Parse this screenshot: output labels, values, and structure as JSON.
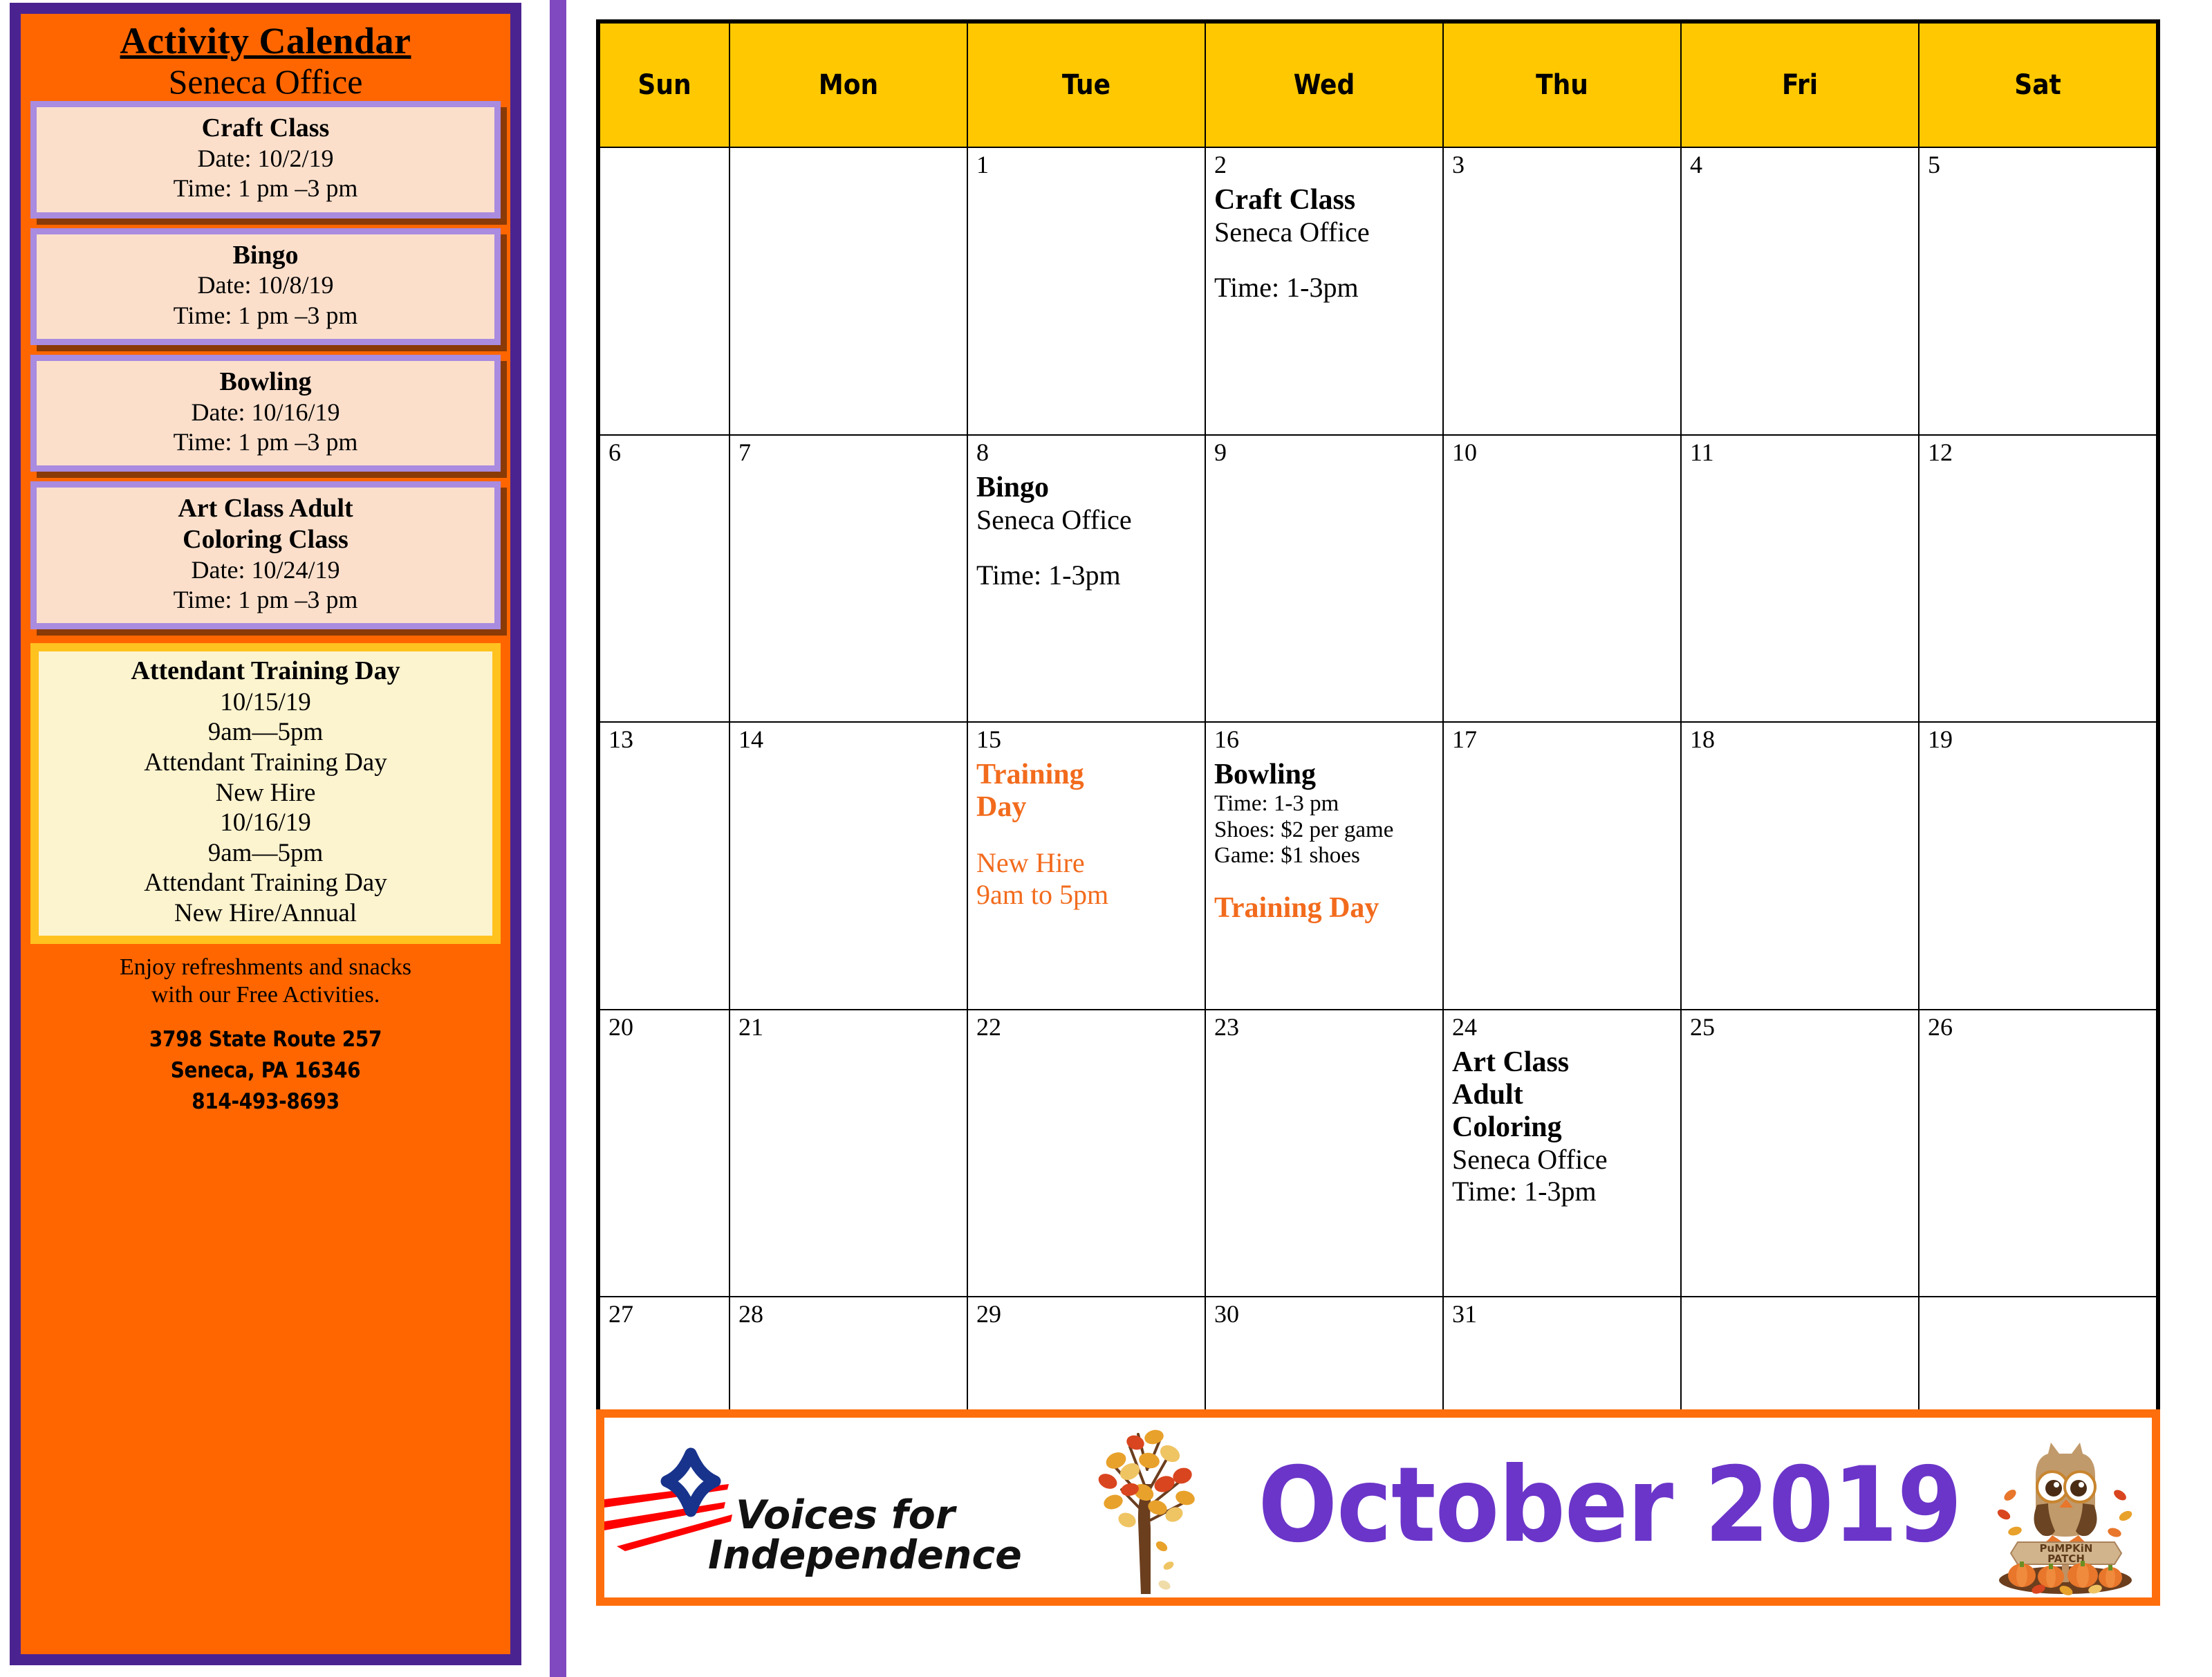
{
  "sidebar": {
    "title_main": "Activity Calendar",
    "title_sub": "Seneca Office",
    "events": [
      {
        "name": "Craft Class",
        "date": "Date: 10/2/19",
        "time": "Time: 1 pm –3 pm"
      },
      {
        "name": "Bingo",
        "date": "Date: 10/8/19",
        "time": "Time: 1 pm –3 pm"
      },
      {
        "name": "Bowling",
        "date": "Date: 10/16/19",
        "time": "Time: 1 pm –3 pm"
      },
      {
        "name": "Art Class Adult",
        "name2": "Coloring Class",
        "date": "Date: 10/24/19",
        "time": "Time: 1 pm –3 pm"
      }
    ],
    "training": {
      "title": "Attendant Training Day",
      "l1": "10/15/19",
      "l2": "9am—5pm",
      "l3": "Attendant Training Day",
      "l4": "New Hire",
      "l5": "10/16/19",
      "l6": "9am—5pm",
      "l7": "Attendant Training Day",
      "l8": "New Hire/Annual"
    },
    "note_line1": "Enjoy refreshments and snacks",
    "note_line2": "with our Free Activities.",
    "address_line1": "3798 State Route 257",
    "address_line2": "Seneca, PA 16346",
    "phone": "814-493-8693"
  },
  "calendar": {
    "weekday_headers": [
      "Sun",
      "Mon",
      "Tue",
      "Wed",
      "Thu",
      "Fri",
      "Sat"
    ],
    "weeks": [
      {
        "days": [
          {
            "num": ""
          },
          {
            "num": ""
          },
          {
            "num": "1"
          },
          {
            "num": "2",
            "event": {
              "title": "Craft Class",
              "location": "Seneca Office",
              "time": "Time: 1-3pm"
            }
          },
          {
            "num": "3"
          },
          {
            "num": "4"
          },
          {
            "num": "5"
          }
        ]
      },
      {
        "days": [
          {
            "num": "6"
          },
          {
            "num": "7"
          },
          {
            "num": "8",
            "event": {
              "title": "Bingo",
              "location": "Seneca Office",
              "time": "Time: 1-3pm"
            }
          },
          {
            "num": "9"
          },
          {
            "num": "10"
          },
          {
            "num": "11"
          },
          {
            "num": "12"
          }
        ]
      },
      {
        "days": [
          {
            "num": "13"
          },
          {
            "num": "14"
          },
          {
            "num": "15",
            "training": {
              "title_l1": "Training",
              "title_l2": "Day",
              "sub_l1": "New Hire",
              "sub_l2": "9am to 5pm"
            }
          },
          {
            "num": "16",
            "bowling": {
              "title": "Bowling",
              "l1": "Time: 1-3 pm",
              "l2": "Shoes: $2 per game",
              "l3": "Game: $1 shoes",
              "tag": "Training Day"
            }
          },
          {
            "num": "17"
          },
          {
            "num": "18"
          },
          {
            "num": "19"
          }
        ]
      },
      {
        "days": [
          {
            "num": "20"
          },
          {
            "num": "21"
          },
          {
            "num": "22"
          },
          {
            "num": "23"
          },
          {
            "num": "24",
            "art": {
              "t1": "Art Class",
              "t2": "Adult",
              "t3": "Coloring",
              "location": "Seneca Office",
              "time": "Time: 1-3pm"
            }
          },
          {
            "num": "25"
          },
          {
            "num": "26"
          }
        ]
      },
      {
        "days": [
          {
            "num": "27"
          },
          {
            "num": "28"
          },
          {
            "num": "29"
          },
          {
            "num": "30"
          },
          {
            "num": "31"
          },
          {
            "num": ""
          },
          {
            "num": ""
          }
        ]
      }
    ]
  },
  "banner": {
    "logo_line1": "Voices for",
    "logo_line2": "Independence",
    "month_title": "October 2019",
    "owl_sign_line1": "PuMPKiN",
    "owl_sign_line2": "PATCH"
  },
  "colors": {
    "sidebar_bg": "#FF6600",
    "sidebar_border": "#4B2391",
    "event_box_bg": "#FBDFCB",
    "event_box_border": "#A98BE0",
    "training_box_bg": "#FCF3CF",
    "training_box_border": "#FFC21F",
    "header_yellow": "#FFC800",
    "accent_purple": "#6B35C9",
    "accent_orange": "#F26B1D",
    "banner_border": "#FF6E0C",
    "divider_purple": "#8049C0"
  }
}
